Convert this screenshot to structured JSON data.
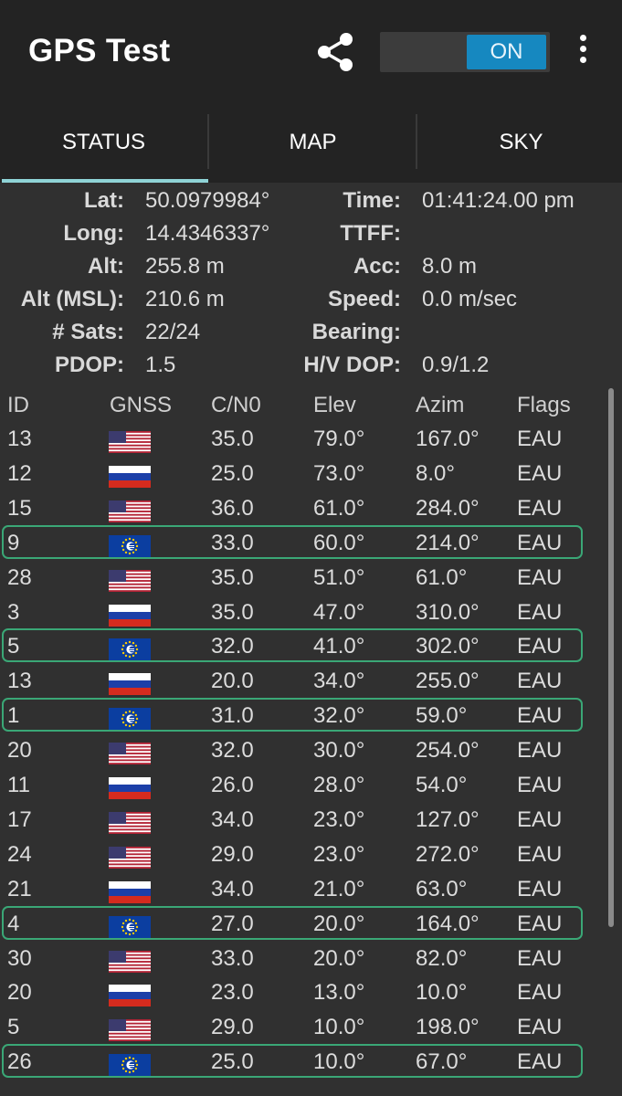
{
  "app": {
    "title": "GPS Test",
    "toggle_label": "ON"
  },
  "tabs": [
    {
      "label": "STATUS"
    },
    {
      "label": "MAP"
    },
    {
      "label": "SKY"
    }
  ],
  "status": {
    "lat_label": "Lat:",
    "lat": "50.0979984°",
    "long_label": "Long:",
    "long": "14.4346337°",
    "alt_label": "Alt:",
    "alt": "255.8 m",
    "alt_msl_label": "Alt (MSL):",
    "alt_msl": "210.6 m",
    "sats_label": "# Sats:",
    "sats": "22/24",
    "pdop_label": "PDOP:",
    "pdop": "1.5",
    "time_label": "Time:",
    "time": "01:41:24.00 pm",
    "ttff_label": "TTFF:",
    "ttff": "",
    "acc_label": "Acc:",
    "acc": "8.0 m",
    "speed_label": "Speed:",
    "speed": "0.0 m/sec",
    "bearing_label": "Bearing:",
    "bearing": "",
    "hvdop_label": "H/V DOP:",
    "hvdop": "0.9/1.2"
  },
  "table": {
    "headers": [
      "ID",
      "GNSS",
      "C/N0",
      "Elev",
      "Azim",
      "Flags"
    ],
    "rows": [
      {
        "id": "13",
        "gnss": "us",
        "cn0": "35.0",
        "elev": "79.0°",
        "azim": "167.0°",
        "flags": "EAU",
        "highlight": false
      },
      {
        "id": "12",
        "gnss": "ru",
        "cn0": "25.0",
        "elev": "73.0°",
        "azim": "8.0°",
        "flags": "EAU",
        "highlight": false
      },
      {
        "id": "15",
        "gnss": "us",
        "cn0": "36.0",
        "elev": "61.0°",
        "azim": "284.0°",
        "flags": "EAU",
        "highlight": false
      },
      {
        "id": "9",
        "gnss": "eu",
        "cn0": "33.0",
        "elev": "60.0°",
        "azim": "214.0°",
        "flags": "EAU",
        "highlight": true
      },
      {
        "id": "28",
        "gnss": "us",
        "cn0": "35.0",
        "elev": "51.0°",
        "azim": "61.0°",
        "flags": "EAU",
        "highlight": false
      },
      {
        "id": "3",
        "gnss": "ru",
        "cn0": "35.0",
        "elev": "47.0°",
        "azim": "310.0°",
        "flags": "EAU",
        "highlight": false
      },
      {
        "id": "5",
        "gnss": "eu",
        "cn0": "32.0",
        "elev": "41.0°",
        "azim": "302.0°",
        "flags": "EAU",
        "highlight": true
      },
      {
        "id": "13",
        "gnss": "ru",
        "cn0": "20.0",
        "elev": "34.0°",
        "azim": "255.0°",
        "flags": "EAU",
        "highlight": false
      },
      {
        "id": "1",
        "gnss": "eu",
        "cn0": "31.0",
        "elev": "32.0°",
        "azim": "59.0°",
        "flags": "EAU",
        "highlight": true
      },
      {
        "id": "20",
        "gnss": "us",
        "cn0": "32.0",
        "elev": "30.0°",
        "azim": "254.0°",
        "flags": "EAU",
        "highlight": false
      },
      {
        "id": "11",
        "gnss": "ru",
        "cn0": "26.0",
        "elev": "28.0°",
        "azim": "54.0°",
        "flags": "EAU",
        "highlight": false
      },
      {
        "id": "17",
        "gnss": "us",
        "cn0": "34.0",
        "elev": "23.0°",
        "azim": "127.0°",
        "flags": "EAU",
        "highlight": false
      },
      {
        "id": "24",
        "gnss": "us",
        "cn0": "29.0",
        "elev": "23.0°",
        "azim": "272.0°",
        "flags": "EAU",
        "highlight": false
      },
      {
        "id": "21",
        "gnss": "ru",
        "cn0": "34.0",
        "elev": "21.0°",
        "azim": "63.0°",
        "flags": "EAU",
        "highlight": false
      },
      {
        "id": "4",
        "gnss": "eu",
        "cn0": "27.0",
        "elev": "20.0°",
        "azim": "164.0°",
        "flags": "EAU",
        "highlight": true
      },
      {
        "id": "30",
        "gnss": "us",
        "cn0": "33.0",
        "elev": "20.0°",
        "azim": "82.0°",
        "flags": "EAU",
        "highlight": false
      },
      {
        "id": "20",
        "gnss": "ru",
        "cn0": "23.0",
        "elev": "13.0°",
        "azim": "10.0°",
        "flags": "EAU",
        "highlight": false
      },
      {
        "id": "5",
        "gnss": "us",
        "cn0": "29.0",
        "elev": "10.0°",
        "azim": "198.0°",
        "flags": "EAU",
        "highlight": false
      },
      {
        "id": "26",
        "gnss": "eu",
        "cn0": "25.0",
        "elev": "10.0°",
        "azim": "67.0°",
        "flags": "EAU",
        "highlight": true
      }
    ]
  },
  "colors": {
    "accent": "#1688c0",
    "tab_indicator": "#8fd3d6",
    "highlight": "#3aa776"
  },
  "icons": {
    "share": "share-icon",
    "more": "more-vert-icon"
  }
}
